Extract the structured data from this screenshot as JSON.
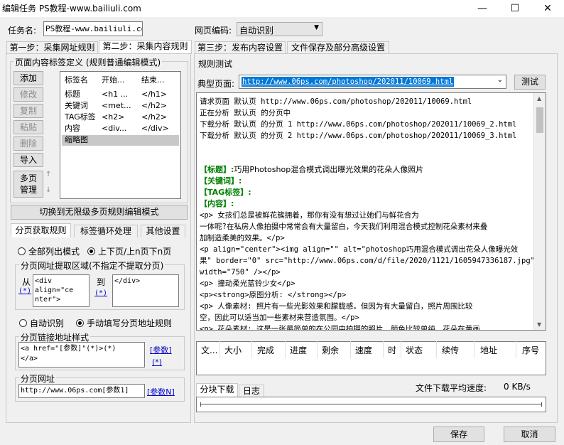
{
  "window": {
    "title": "编辑任务 PS教程-www.bailiuli.com",
    "min_label": "—",
    "max_label": "☐",
    "close_label": "✕"
  },
  "task": {
    "name_label": "任务名:",
    "name_value": "PS教程-www.bailiuli.com",
    "encoding_label": "网页编码:",
    "encoding_value": "自动识别"
  },
  "main_tabs": [
    {
      "label": "第一步：采集网址规则"
    },
    {
      "label": "第二步：采集内容规则"
    },
    {
      "label": "第三步：发布内容设置"
    },
    {
      "label": "文件保存及部分高级设置"
    }
  ],
  "left": {
    "group_title": "页面内容标签定义 (规则普通编辑模式)",
    "buttons": {
      "add": "添加",
      "edit": "修改",
      "copy": "复制",
      "paste": "粘贴",
      "delete": "删除",
      "import": "导入",
      "multipage": "多页\n管理"
    },
    "table": {
      "headers": [
        "标签名",
        "开始...",
        "结束..."
      ],
      "rows": [
        [
          "标题",
          "<h1 ...",
          "</h1>"
        ],
        [
          "关键词",
          "<met...",
          "</h2>"
        ],
        [
          "TAG标签",
          "<h2>",
          "</h2>"
        ],
        [
          "内容",
          "<div...",
          "</div>"
        ],
        [
          "缩略图",
          "",
          ""
        ]
      ]
    },
    "switch_mode_label": "切换到无限级多页规则编辑模式",
    "sub_tabs": [
      {
        "label": "分页获取规则"
      },
      {
        "label": "标签循环处理"
      },
      {
        "label": "其他设置"
      }
    ],
    "mode_all": "全部列出模式",
    "mode_updown": "上下页/上n页下n页",
    "extract_group_title": "分页网址提取区域(不指定不提取分页)",
    "from_label": "从",
    "from_value": "<div\nalign=\"ce\nnter\">",
    "to_label": "到",
    "to_value": "</div>",
    "wildcard": "(*)",
    "auto_detect": "自动识别",
    "manual_fill": "手动填写分页地址规则",
    "link_style_title": "分页链接地址样式",
    "link_style_value": "<a href=\"[参数]\"(*)>(*)\n</a>",
    "param_link": "[参数]",
    "star_link": "(*)",
    "page_url_title": "分页网址",
    "page_url_value": "http://www.06ps.com[参数1]",
    "paramN_link": "[参数N]"
  },
  "right": {
    "group_title": "规则测试",
    "typical_label": "典型页面:",
    "typical_url": "http://www.06ps.com/photoshop/202011/10069.html",
    "test_button": "测试",
    "log_lines": [
      "请求页面 默认页 http://www.06ps.com/photoshop/202011/10069.html",
      "正在分析 默认页 的分页中",
      "下载分析 默认页 的分页 1   http://www.06ps.com/photoshop/202011/10069_2.html",
      "下载分析 默认页 的分页 2   http://www.06ps.com/photoshop/202011/10069_3.html"
    ],
    "result_title_label": "【标题】:",
    "result_title_value": "巧用Photoshop混合模式调出曝光效果的花朵人像照片",
    "result_keywords_label": "【关键词】:",
    "result_tags_label": "【TAG标签】:",
    "result_content_label": "【内容】:",
    "content_lines": [
      "            <p>    女孩们总是被鲜花簇拥着，那你有没有想过让她们与鲜花合为",
      "一体呢?在私房人像拍摄中常常会有大量留白，今天我们利用混合模式控制花朵素材来叠",
      "加制造柔美的效果。</p>",
      "<p align=\"center\"><img align=\"\" alt=\"photoshop巧用混合模式调出花朵人像曝光效",
      "果\" border=\"0\" src=\"http://www.06ps.com/d/file/2020/1121/1605947336187.jpg\"",
      "width=\"750\" /></p>",
      "<p>    撞动柔光蓝铃少女</p>",
      "<p><strong>原图分析: </strong></p>",
      "<p>    人像素材: 照片有一些光影效果和朦胧感。但因为有大量留白，照片周围比较",
      "空，因此可以适当加一些素材来营造氛围。</p>",
      "<p>    花朵素材: 这是一张最简单的在公园中拍摄的照片。颜色比较单纯，花朵在黄画"
    ],
    "download_columns": [
      "文...",
      "大小",
      "完成",
      "进度",
      "剩余",
      "速度",
      "时",
      "状态",
      "续传",
      "地址",
      "序号"
    ],
    "bottom_tabs": [
      {
        "label": "分块下载"
      },
      {
        "label": "日志"
      }
    ],
    "avg_speed_label": "文件下载平均速度:",
    "avg_speed_value": "0 KB/s"
  },
  "footer": {
    "save_label": "保存",
    "cancel_label": "取消"
  },
  "colors": {
    "selection": "#0078d7",
    "green_label": "#008000",
    "link": "#0000cc"
  }
}
